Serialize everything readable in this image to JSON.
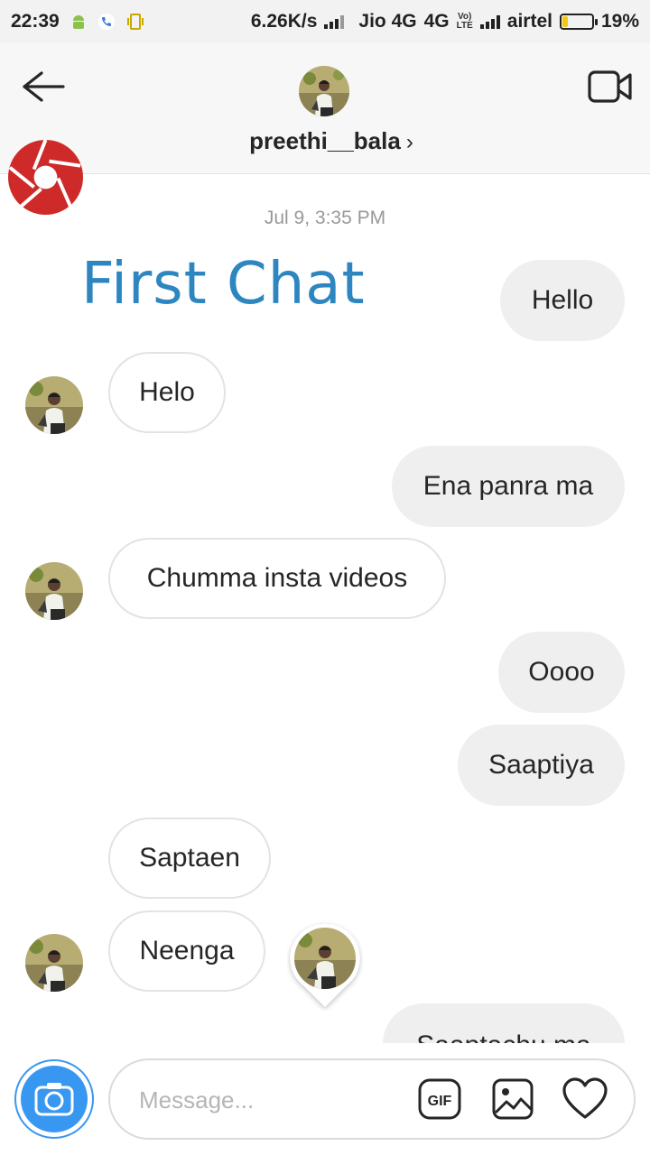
{
  "status_bar": {
    "time": "22:39",
    "net_speed": "6.26K/s",
    "carrier1": "Jio 4G",
    "network_type": "4G",
    "volte": "Vo) LTE",
    "carrier2": "airtel",
    "battery": "19%",
    "battery_level": 0.19,
    "icons": [
      "android-icon",
      "phone-call-icon",
      "vibrate-icon"
    ]
  },
  "header": {
    "username": "preethi__bala",
    "chevron": "›",
    "icons": [
      "back-arrow-icon",
      "video-call-icon",
      "profile-avatar"
    ]
  },
  "colors": {
    "title_blue": "#2e86c1",
    "logo_red": "#cf2a2a",
    "outgoing_bubble": "#efefef",
    "camera_blue": "#3897f0"
  },
  "chat": {
    "date_stamp": "Jul 9, 3:35 PM",
    "overlay_title": "First Chat",
    "messages": [
      {
        "dir": "out",
        "text": "Hello"
      },
      {
        "dir": "in",
        "text": "Helo"
      },
      {
        "dir": "out",
        "text": "Ena panra ma"
      },
      {
        "dir": "in",
        "text": "Chumma insta videos"
      },
      {
        "dir": "out",
        "text": "Oooo"
      },
      {
        "dir": "out",
        "text": "Saaptiya"
      },
      {
        "dir": "in",
        "text": "Saptaen"
      },
      {
        "dir": "in",
        "text": "Neenga"
      },
      {
        "dir": "out",
        "text": "Saaptachu ma"
      }
    ]
  },
  "composer": {
    "placeholder": "Message...",
    "gif_label": "GIF"
  }
}
